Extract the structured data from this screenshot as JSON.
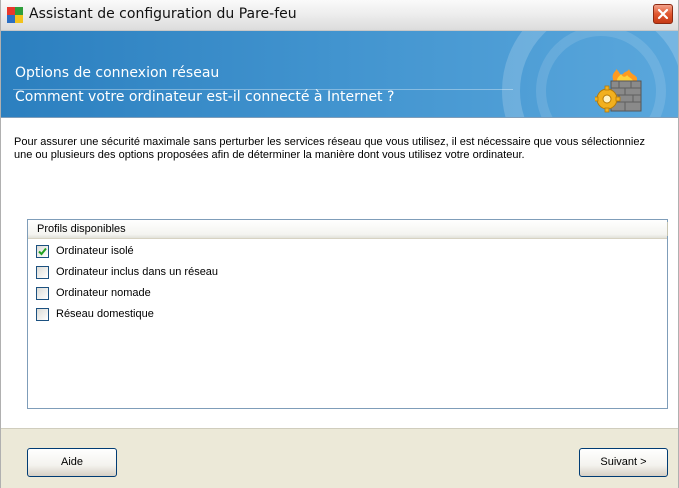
{
  "window": {
    "title": "Assistant de configuration du Pare-feu"
  },
  "header": {
    "line1": "Options de connexion réseau",
    "line2": "Comment votre ordinateur est-il connecté à Internet ?"
  },
  "intro_text": "Pour assurer une sécurité maximale sans perturber les services réseau que vous utilisez, il est nécessaire que vous sélectionniez une ou plusieurs des options proposées afin de déterminer la manière dont vous utilisez votre ordinateur.",
  "profiles": {
    "column_header": "Profils disponibles",
    "items": [
      {
        "label": "Ordinateur isolé",
        "checked": true
      },
      {
        "label": "Ordinateur inclus dans un réseau",
        "checked": false
      },
      {
        "label": "Ordinateur nomade",
        "checked": false
      },
      {
        "label": "Réseau domestique",
        "checked": false
      }
    ]
  },
  "buttons": {
    "help": "Aide",
    "next": "Suivant >"
  },
  "colors": {
    "banner": "#3a8dca",
    "close": "#e0572f",
    "check": "#21a121"
  },
  "icons": [
    "avg-app-icon",
    "close-icon",
    "firewall-icon",
    "checkmark-icon"
  ]
}
